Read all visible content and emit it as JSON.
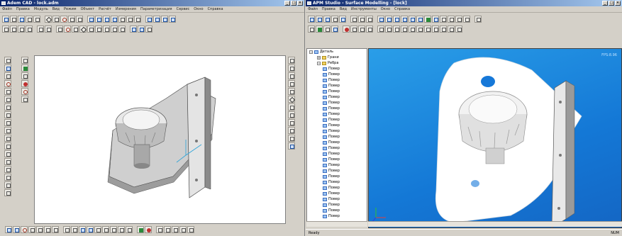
{
  "left_window": {
    "title": "Adem CAD - lock.adm",
    "menu": [
      "Файл",
      "Правка",
      "Модуль",
      "Вид",
      "Режим",
      "Объект",
      "Расчёт",
      "Измерения",
      "Параметризация",
      "Сервис",
      "Окно",
      "Справка"
    ],
    "icons": [
      "new-icon",
      "open-icon",
      "save-icon",
      "print-icon",
      "line-icon",
      "arc-icon",
      "circle-icon",
      "rect-icon",
      "view-icon",
      "zoom-icon",
      "dimension-icon",
      "text-icon"
    ]
  },
  "right_window": {
    "title": "APM Studio - Surface Modelling - [lock]",
    "menu": [
      "Файл",
      "Правка",
      "Вид",
      "Инструменты",
      "Окно",
      "Справка"
    ],
    "fps": "FPS:8.96",
    "tree": {
      "root": "Деталь",
      "children": [
        "Грани",
        "Ребра"
      ],
      "items": [
        "Повер",
        "Повер",
        "Повер",
        "Повер",
        "Повер",
        "Повер",
        "Повер",
        "Повер",
        "Повер",
        "Повер",
        "Повер",
        "Повер",
        "Повер",
        "Повер",
        "Повер",
        "Повер",
        "Повер",
        "Повер",
        "Повер",
        "Повер",
        "Повер",
        "Повер",
        "Повер",
        "Повер",
        "Повер",
        "Повер",
        "Повер"
      ]
    },
    "status_left": "Ready",
    "status_right": "NUM"
  },
  "colors": {
    "title_active": "#0a246a",
    "viewport_blue": "#1478d6",
    "model_gray": "#b8b8b8"
  }
}
